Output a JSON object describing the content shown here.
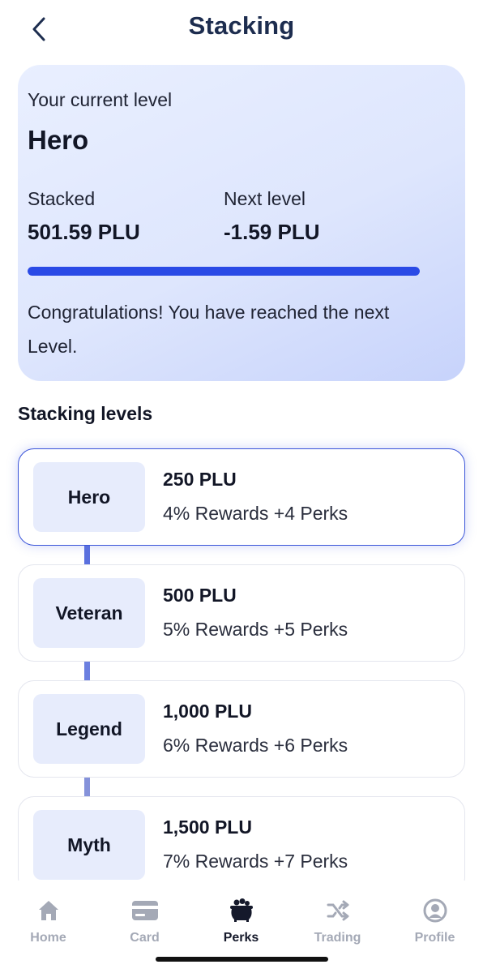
{
  "header": {
    "title": "Stacking",
    "back_icon": "chevron-left-icon"
  },
  "current": {
    "caption": "Your current level",
    "level": "Hero",
    "stacked_label": "Stacked",
    "stacked_value": "501.59 PLU",
    "next_label": "Next level",
    "next_value": "-1.59 PLU",
    "progress_percent": 100,
    "message": "Congratulations! You have reached the next Level."
  },
  "levels_section": {
    "title": "Stacking levels",
    "items": [
      {
        "name": "Hero",
        "amount": "250 PLU",
        "rewards": "4% Rewards  +4 Perks",
        "active": true
      },
      {
        "name": "Veteran",
        "amount": "500 PLU",
        "rewards": "5% Rewards  +5 Perks",
        "active": false
      },
      {
        "name": "Legend",
        "amount": "1,000 PLU",
        "rewards": "6% Rewards  +6 Perks",
        "active": false
      },
      {
        "name": "Myth",
        "amount": "1,500 PLU",
        "rewards": "7% Rewards  +7 Perks",
        "active": false
      }
    ]
  },
  "tabbar": {
    "tabs": [
      {
        "label": "Home",
        "icon": "home-icon"
      },
      {
        "label": "Card",
        "icon": "card-icon"
      },
      {
        "label": "Perks",
        "icon": "perks-pot-icon",
        "active": true
      },
      {
        "label": "Trading",
        "icon": "shuffle-icon"
      },
      {
        "label": "Profile",
        "icon": "profile-icon"
      }
    ]
  },
  "colors": {
    "accent": "#2a4ae6",
    "title": "#1d2d4f",
    "inactive_tab": "#a4a9b6"
  }
}
